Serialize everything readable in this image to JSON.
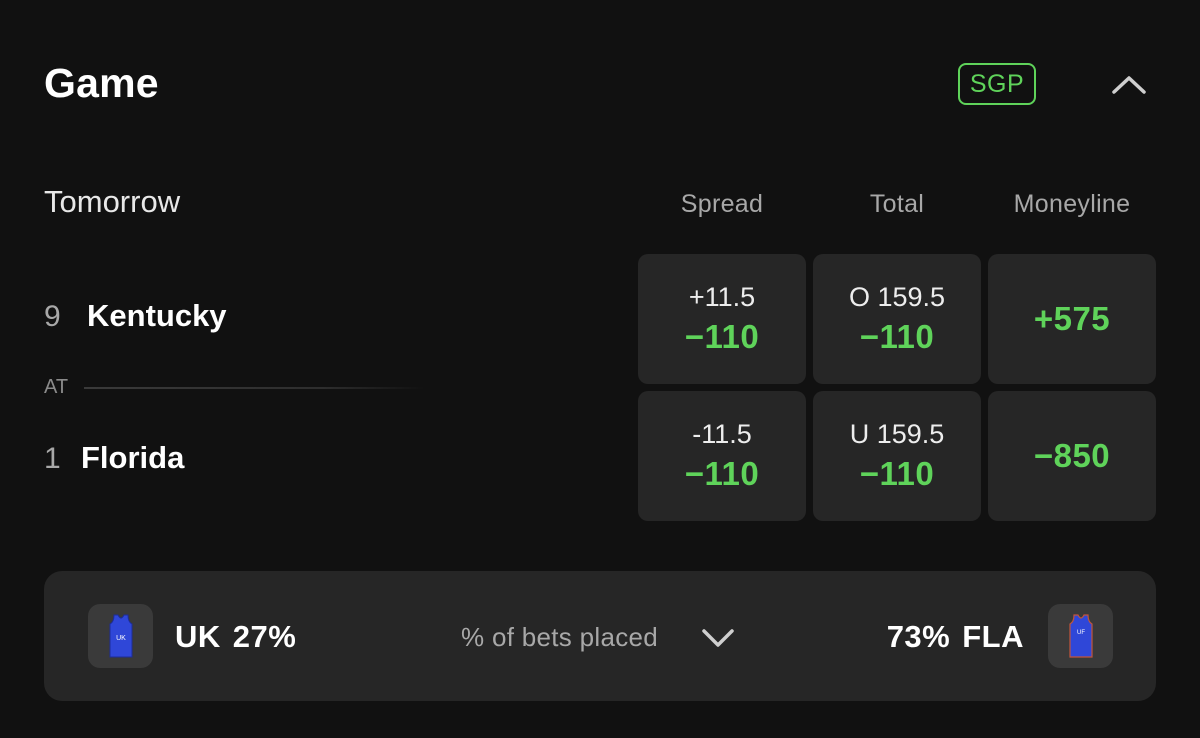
{
  "header": {
    "title": "Game",
    "sgp_badge": "SGP",
    "collapse_icon": "chevron-up-icon"
  },
  "subheader": {
    "when": "Tomorrow",
    "columns": [
      "Spread",
      "Total",
      "Moneyline"
    ]
  },
  "teams": {
    "away": {
      "rank": "9",
      "name": "Kentucky"
    },
    "separator": "AT",
    "home": {
      "rank": "1",
      "name": "Florida"
    }
  },
  "odds": {
    "away": {
      "spread": {
        "line": "+11.5",
        "price": "−110"
      },
      "total": {
        "line": "O 159.5",
        "price": "−110"
      },
      "moneyline": {
        "price": "+575"
      }
    },
    "home": {
      "spread": {
        "line": "-11.5",
        "price": "−110"
      },
      "total": {
        "line": "U 159.5",
        "price": "−110"
      },
      "moneyline": {
        "price": "−850"
      }
    }
  },
  "bets": {
    "left": {
      "team": "UK",
      "percent": "27%",
      "jersey_text": "UK",
      "icon": "jersey-icon"
    },
    "label": "% of bets placed",
    "expand_icon": "chevron-down-icon",
    "right": {
      "team": "FLA",
      "percent": "73%",
      "jersey_text": "UF",
      "icon": "jersey-icon"
    }
  },
  "colors": {
    "background": "#111111",
    "panel": "#262626",
    "accent_green": "#5fd35a",
    "muted_text": "#a8a8a8",
    "jersey_blue": "#2f47d8"
  }
}
